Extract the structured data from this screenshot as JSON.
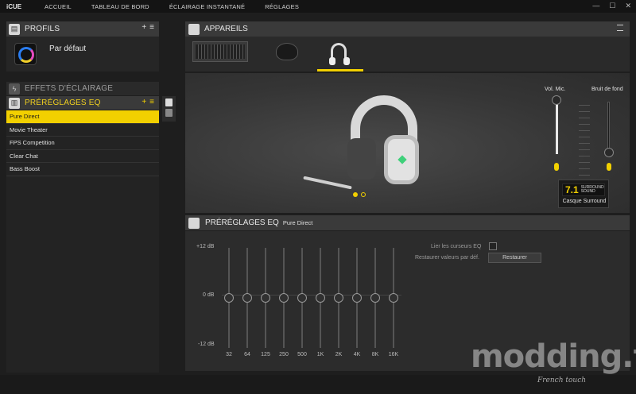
{
  "app": {
    "brand": "iCUE"
  },
  "nav": [
    "ACCUEIL",
    "TABLEAU DE BORD",
    "ÉCLAIRAGE INSTANTANÉ",
    "RÉGLAGES"
  ],
  "window": {
    "minimize": "—",
    "maximize": "☐",
    "close": "✕"
  },
  "profiles": {
    "title": "PROFILS",
    "add": "+",
    "menu": "≡",
    "current": "Par défaut"
  },
  "effects": {
    "title": "EFFETS D'ÉCLAIRAGE"
  },
  "eq_presets": {
    "title": "PRÉRÉGLAGES EQ",
    "add": "+",
    "menu": "≡",
    "items": [
      "Pure Direct",
      "Movie Theater",
      "FPS Competition",
      "Clear Chat",
      "Bass Boost"
    ],
    "selected_index": 0
  },
  "devices": {
    "title": "APPAREILS"
  },
  "mic_volume": {
    "label": "Vol. Mic.",
    "level": 1.0
  },
  "sidetone": {
    "label": "Bruit de fond",
    "level": 0.0
  },
  "surround": {
    "number": "7.1",
    "line1": "SURROUND",
    "line2": "SOUND",
    "label": "Casque Surround"
  },
  "eq_panel": {
    "title": "PRÉRÉGLAGES EQ",
    "preset_name": "Pure Direct",
    "db_top": "+12 dB",
    "db_mid": "0 dB",
    "db_bot": "-12 dB",
    "link_label": "Lier les curseurs EQ",
    "reset_label": "Restaurer valeurs par déf.",
    "reset_button": "Restaurer",
    "bands": [
      "32",
      "64",
      "125",
      "250",
      "500",
      "1K",
      "2K",
      "4K",
      "8K",
      "16K"
    ],
    "gains_db": [
      0,
      0,
      0,
      0,
      0,
      0,
      0,
      0,
      0,
      0
    ]
  },
  "watermark": {
    "main": "modding.fr",
    "sub": "French touch"
  },
  "colors": {
    "accent": "#f2d000",
    "panel": "#3a3a3a",
    "background": "#1e1e1e"
  }
}
